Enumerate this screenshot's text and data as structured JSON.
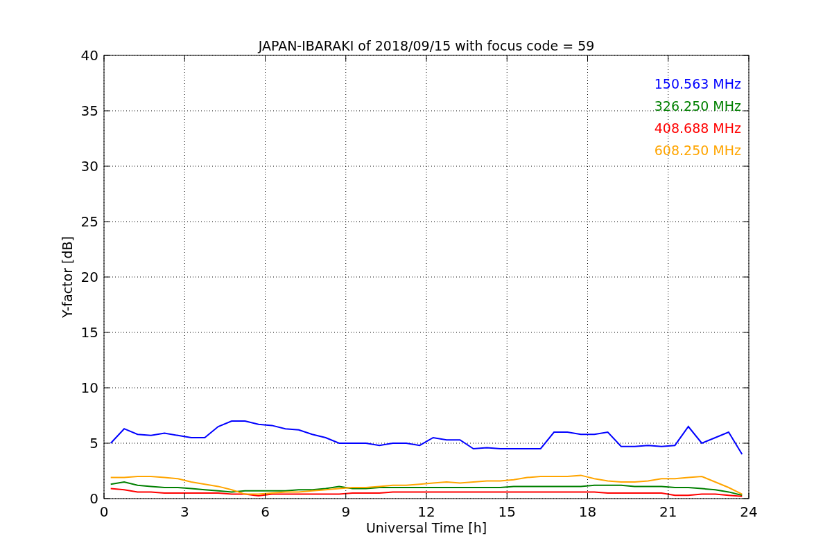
{
  "figure": {
    "chart_data": {
      "type": "line",
      "title": "JAPAN-IBARAKI of 2018/09/15 with focus code = 59",
      "xlabel": "Universal Time [h]",
      "ylabel": "Y-factor [dB]",
      "x": [
        0.25,
        0.75,
        1.25,
        1.75,
        2.25,
        2.75,
        3.25,
        3.75,
        4.25,
        4.75,
        5.25,
        5.75,
        6.25,
        6.75,
        7.25,
        7.75,
        8.25,
        8.75,
        9.25,
        9.75,
        10.25,
        10.75,
        11.25,
        11.75,
        12.25,
        12.75,
        13.25,
        13.75,
        14.25,
        14.75,
        15.25,
        15.75,
        16.25,
        16.75,
        17.25,
        17.75,
        18.25,
        18.75,
        19.25,
        19.75,
        20.25,
        20.75,
        21.25,
        21.75,
        22.25,
        22.75,
        23.25,
        23.75
      ],
      "series": [
        {
          "name": "150.563 MHz",
          "color": "#0000ff",
          "values": [
            5,
            6.3,
            5.8,
            5.7,
            5.9,
            5.7,
            5.5,
            5.5,
            6.5,
            7,
            7,
            6.7,
            6.6,
            6.3,
            6.2,
            5.8,
            5.5,
            5,
            5,
            5,
            4.8,
            5,
            5,
            4.8,
            5.5,
            5.3,
            5.3,
            4.5,
            4.6,
            4.5,
            4.5,
            4.5,
            4.5,
            6,
            6,
            5.8,
            5.8,
            6,
            4.7,
            4.7,
            4.8,
            4.7,
            4.8,
            6.5,
            5,
            5.5,
            6,
            4
          ]
        },
        {
          "name": "326.250 MHz",
          "color": "#008000",
          "values": [
            1.3,
            1.5,
            1.2,
            1.1,
            1,
            1,
            0.9,
            0.8,
            0.7,
            0.6,
            0.7,
            0.7,
            0.7,
            0.7,
            0.8,
            0.8,
            0.9,
            1.1,
            0.9,
            0.9,
            1,
            1,
            1,
            1,
            1,
            1,
            1,
            1,
            1,
            1,
            1.1,
            1.1,
            1.1,
            1.1,
            1.1,
            1.1,
            1.2,
            1.2,
            1.2,
            1.1,
            1.1,
            1.1,
            1,
            1,
            0.9,
            0.8,
            0.6,
            0.3
          ]
        },
        {
          "name": "408.688 MHz",
          "color": "#ff0000",
          "values": [
            0.9,
            0.8,
            0.6,
            0.6,
            0.5,
            0.5,
            0.5,
            0.5,
            0.5,
            0.4,
            0.4,
            0.25,
            0.4,
            0.4,
            0.4,
            0.4,
            0.4,
            0.4,
            0.5,
            0.5,
            0.5,
            0.6,
            0.6,
            0.6,
            0.6,
            0.6,
            0.6,
            0.6,
            0.6,
            0.6,
            0.6,
            0.6,
            0.6,
            0.6,
            0.6,
            0.6,
            0.6,
            0.5,
            0.5,
            0.5,
            0.5,
            0.5,
            0.3,
            0.3,
            0.4,
            0.4,
            0.3,
            0.2
          ]
        },
        {
          "name": "608.250 MHz",
          "color": "#ffa500",
          "values": [
            1.9,
            1.9,
            2,
            2,
            1.9,
            1.8,
            1.5,
            1.3,
            1.1,
            0.8,
            0.4,
            0.4,
            0.5,
            0.6,
            0.6,
            0.7,
            0.8,
            0.9,
            1,
            1,
            1.1,
            1.2,
            1.2,
            1.3,
            1.4,
            1.5,
            1.4,
            1.5,
            1.6,
            1.6,
            1.7,
            1.9,
            2,
            2,
            2,
            2.1,
            1.8,
            1.6,
            1.5,
            1.5,
            1.6,
            1.8,
            1.8,
            1.9,
            2,
            1.5,
            1,
            0.4
          ]
        }
      ],
      "grid": true,
      "xlim": [
        0,
        24
      ],
      "ylim": [
        0,
        40
      ],
      "xticks": [
        0,
        3,
        6,
        9,
        12,
        15,
        18,
        21,
        24
      ],
      "yticks": [
        0,
        5,
        10,
        15,
        20,
        25,
        30,
        35,
        40
      ]
    }
  }
}
